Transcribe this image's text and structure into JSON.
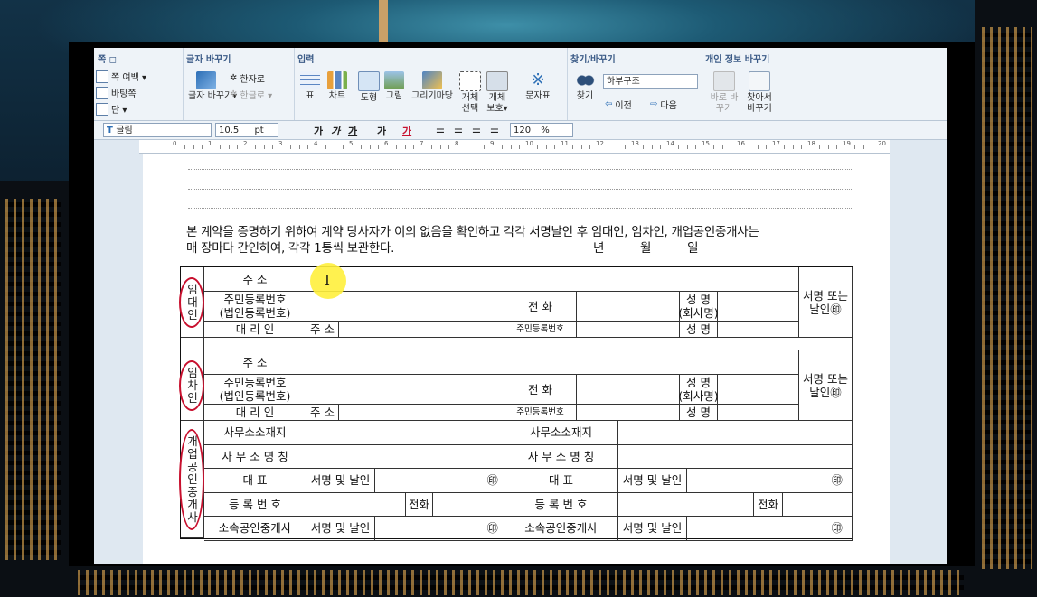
{
  "ribbon": {
    "groups": [
      {
        "title": "쪽 ◻",
        "items": [
          "쪽 여백 ▾",
          "바탕쪽",
          "단 ▾"
        ]
      },
      {
        "title": "글자 바꾸기",
        "items": [
          "글자 바꾸기▾",
          "한자로",
          "한글로 ▾"
        ]
      },
      {
        "title": "입력",
        "items": [
          "표",
          "차트",
          "도형",
          "그림",
          "그리기마당",
          "개체 선택",
          "개체 보호▾",
          "문자표"
        ]
      },
      {
        "title": "찾기/바꾸기",
        "items": [
          "찾기",
          "하부구조",
          "이전",
          "다음"
        ]
      },
      {
        "title": "개인 정보 바꾸기",
        "items": [
          "바로 바꾸기",
          "찾아서 바꾸기"
        ]
      }
    ]
  },
  "format_bar": {
    "font": "글림",
    "size": "10.5",
    "unit": "pt",
    "bold": "가",
    "italic": "가",
    "underline": "가",
    "strike": "가",
    "color": "가",
    "line_spacing": "120",
    "percent": "%"
  },
  "ruler_numbers": [
    "0",
    "1",
    "2",
    "3",
    "4",
    "5",
    "6",
    "7",
    "8",
    "9",
    "10",
    "11",
    "12",
    "13",
    "14",
    "15",
    "16",
    "17",
    "18",
    "19",
    "20"
  ],
  "document": {
    "paragraph_line1": "본 계약을 증명하기 위하여 계약 당사자가 이의 없음을 확인하고 각각 서명날인 후 임대인, 임차인, 개업공인중개사는",
    "paragraph_line2": "매 장마다 간인하여, 각각 1통씩 보관한다.",
    "date": "년          월          일"
  },
  "contract": {
    "landlord": [
      "임",
      "대",
      "인"
    ],
    "tenant": [
      "임",
      "차",
      "인"
    ],
    "agent": [
      "개",
      "업",
      "공",
      "인",
      "중",
      "개",
      "사"
    ],
    "address": "주          소",
    "resident_no_1": "주민등록번호",
    "resident_no_2": "(법인등록번호)",
    "phone": "전     화",
    "name": "성 명",
    "name_corp": "(회사명)",
    "sign_or_seal_1": "서명 또는",
    "sign_or_seal_2": "날인㊞",
    "proxy": "대     리     인",
    "addr_short": "주 소",
    "resident_short": "주민등록번호",
    "name_short": "성 명",
    "office_addr": "사무소소재지",
    "office_name": "사 무 소 명 칭",
    "representative": "대          표",
    "sign_seal": "서명 및 날인",
    "seal_mark": "㊞",
    "reg_no": "등  록  번  호",
    "tel": "전화",
    "affiliated": "소속공인중개사"
  },
  "colors": {
    "annotation_oval": "#c8102e",
    "cursor_highlight": "#fff03c",
    "ribbon_title": "#3a5a86"
  }
}
